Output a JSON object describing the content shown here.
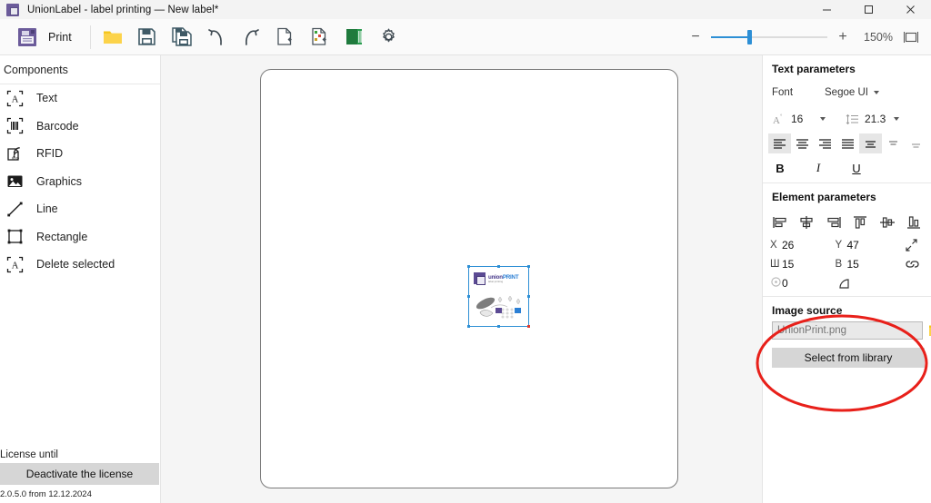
{
  "window": {
    "title": "UnionLabel - label printing — New label*",
    "app_icon": "app-window-icon",
    "minimize": "−",
    "maximize": "□",
    "close": "✕"
  },
  "toolbar": {
    "print_label": "Print",
    "print_icon": "printer-icon",
    "buttons": [
      {
        "name": "open-file",
        "icon": "folder-icon",
        "tooltip": "Open"
      },
      {
        "name": "save-file",
        "icon": "floppy-disk-icon",
        "tooltip": "Save"
      },
      {
        "name": "save-as-file",
        "icon": "floppy-disk-multiple-icon",
        "tooltip": "Save as"
      },
      {
        "name": "undo",
        "icon": "undo-arrow-icon",
        "tooltip": "Undo"
      },
      {
        "name": "redo",
        "icon": "redo-arrow-icon",
        "tooltip": "Redo"
      },
      {
        "name": "new-label",
        "icon": "new-document-icon",
        "tooltip": "New label"
      },
      {
        "name": "new-label-from-template",
        "icon": "document-template-icon",
        "tooltip": "New from template"
      },
      {
        "name": "library",
        "icon": "book-green-icon",
        "tooltip": "Library"
      },
      {
        "name": "settings",
        "icon": "gear-icon",
        "tooltip": "Settings"
      }
    ],
    "zoom": {
      "minus": "−",
      "plus": "+",
      "value": "150%",
      "percent_number": 150,
      "slider_position_pct": 32,
      "fit_icon": "fit-to-screen-icon"
    },
    "accent_color": "#2d8fd5"
  },
  "sidebar": {
    "header": "Components",
    "items": [
      {
        "label": "Text",
        "icon": "text-box-icon"
      },
      {
        "label": "Barcode",
        "icon": "barcode-icon"
      },
      {
        "label": "RFID",
        "icon": "rfid-tag-icon"
      },
      {
        "label": "Graphics",
        "icon": "image-picture-icon"
      },
      {
        "label": "Line",
        "icon": "line-diagonal-icon"
      },
      {
        "label": "Rectangle",
        "icon": "rectangle-icon"
      },
      {
        "label": "Delete selected",
        "icon": "text-box-icon"
      }
    ],
    "license_label": "License until",
    "deactivate_button": "Deactivate the license",
    "version": "2.0.5.0 from 12.12.2024"
  },
  "canvas": {
    "label_background": "#ffffff",
    "work_background": "#f5f5f5",
    "selected_element": {
      "name": "union-print-image",
      "logo_union": "union",
      "logo_print": "PRINT",
      "logo_subtitle": "UnionPrint label",
      "selection_color": "#2d8fd5",
      "resize_handle_color": "#e03b2f"
    }
  },
  "text_parameters": {
    "title": "Text parameters",
    "font_label": "Font",
    "font_value": "Segoe UI",
    "font_size_icon": "font-size-icon",
    "font_size_value": "16",
    "line_spacing_icon": "line-spacing-icon",
    "line_spacing_value": "21.3",
    "align_buttons": [
      {
        "name": "align-left",
        "icon": "align-left-icon",
        "active": true
      },
      {
        "name": "align-center",
        "icon": "align-center-icon",
        "active": false
      },
      {
        "name": "align-right",
        "icon": "align-right-icon",
        "active": false
      },
      {
        "name": "align-justify",
        "icon": "align-justify-icon",
        "active": false
      },
      {
        "name": "align-vertical-center",
        "icon": "align-middle-icon",
        "active": true
      },
      {
        "name": "align-vertical-top",
        "icon": "align-top-icon",
        "active": false
      },
      {
        "name": "align-vertical-bottom",
        "icon": "align-bottom-icon",
        "active": false
      }
    ],
    "bold": "B",
    "italic": "I",
    "underline": "U"
  },
  "element_parameters": {
    "title": "Element parameters",
    "align_icons": [
      {
        "name": "align-element-left",
        "icon": "align-object-left-icon"
      },
      {
        "name": "align-element-center-h",
        "icon": "align-object-center-h-icon"
      },
      {
        "name": "align-element-right",
        "icon": "align-object-right-icon"
      },
      {
        "name": "align-element-top",
        "icon": "align-object-top-icon"
      },
      {
        "name": "align-element-center-v",
        "icon": "align-object-center-v-icon"
      },
      {
        "name": "align-element-bottom",
        "icon": "align-object-bottom-icon"
      }
    ],
    "x_label": "X",
    "x_value": "26",
    "y_label": "Y",
    "y_value": "47",
    "resize_icon": "resize-diagonal-icon",
    "width_label": "Ш",
    "width_value": "15",
    "height_label": "В",
    "height_value": "15",
    "link_icon": "link-chain-icon",
    "rotation_icon": "rotation-icon",
    "rotation_value": "0",
    "corner_icon": "corner-radius-icon"
  },
  "image_source": {
    "title": "Image source",
    "input_value": "UnionPrint.png",
    "input_placeholder": "UnionPrint.png",
    "browse_icon": "folder-open-icon",
    "select_button": "Select from library"
  },
  "annotation": {
    "type": "ellipse-highlight",
    "color": "#e8201a"
  }
}
